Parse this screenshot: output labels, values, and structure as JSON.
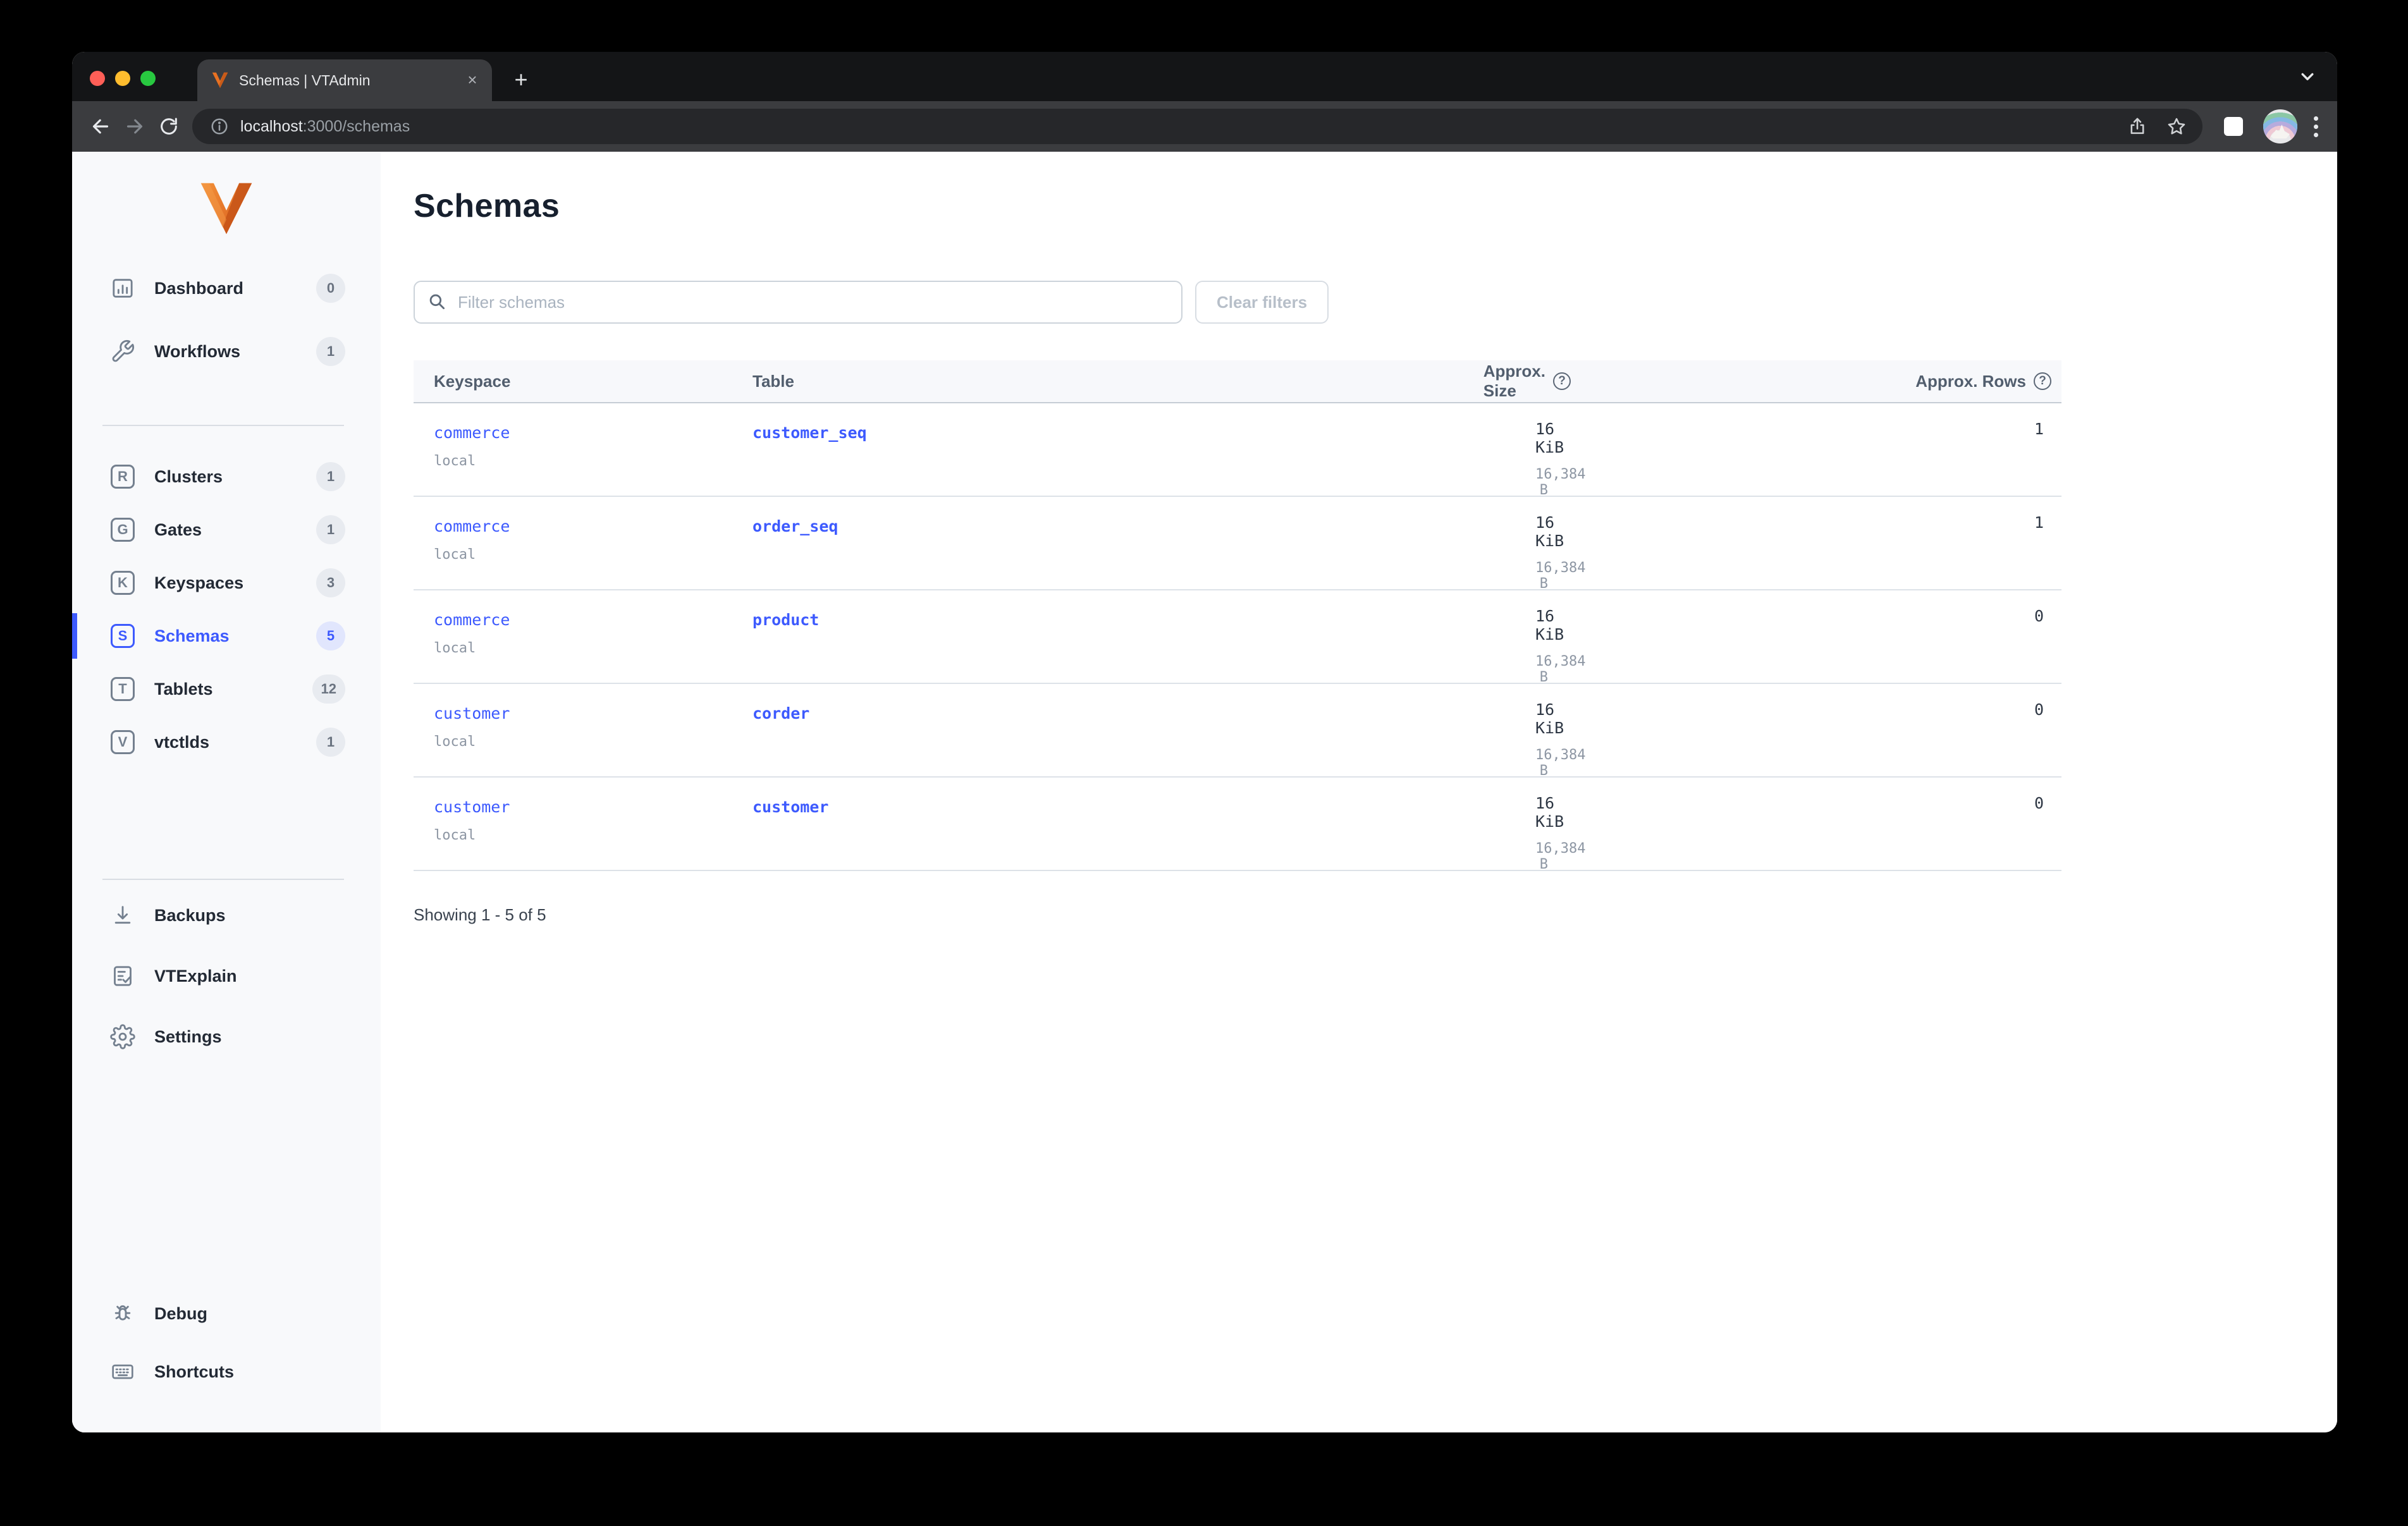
{
  "colors": {
    "accent": "#3d5afe",
    "logo_orange": "#e87122",
    "traffic_red": "#ff5f57",
    "traffic_yellow": "#febc2e",
    "traffic_green": "#28c840"
  },
  "browser": {
    "tab_title": "Schemas | VTAdmin",
    "url_host": "localhost",
    "url_rest": ":3000/schemas",
    "new_tab_glyph": "+",
    "tab_close_glyph": "×"
  },
  "sidebar": {
    "top": [
      {
        "label": "Dashboard",
        "badge": "0",
        "icon": "dashboard-icon"
      },
      {
        "label": "Workflows",
        "badge": "1",
        "icon": "wrench-icon"
      }
    ],
    "mid": [
      {
        "label": "Clusters",
        "badge": "1",
        "icon": "cluster-letter-icon",
        "letter": "R"
      },
      {
        "label": "Gates",
        "badge": "1",
        "icon": "gate-letter-icon",
        "letter": "G"
      },
      {
        "label": "Keyspaces",
        "badge": "3",
        "icon": "keyspace-letter-icon",
        "letter": "K"
      },
      {
        "label": "Schemas",
        "badge": "5",
        "icon": "schema-letter-icon",
        "letter": "S",
        "active": true
      },
      {
        "label": "Tablets",
        "badge": "12",
        "icon": "tablet-letter-icon",
        "letter": "T"
      },
      {
        "label": "vtctlds",
        "badge": "1",
        "icon": "vtctld-letter-icon",
        "letter": "V"
      }
    ],
    "tools": [
      {
        "label": "Backups",
        "icon": "download-icon"
      },
      {
        "label": "VTExplain",
        "icon": "document-check-icon"
      },
      {
        "label": "Settings",
        "icon": "gear-icon"
      }
    ],
    "bottom": [
      {
        "label": "Debug",
        "icon": "bug-icon"
      },
      {
        "label": "Shortcuts",
        "icon": "keyboard-icon"
      }
    ]
  },
  "main": {
    "title": "Schemas",
    "filter_placeholder": "Filter schemas",
    "clear_button": "Clear filters",
    "table": {
      "headers": [
        "Keyspace",
        "Table",
        "Approx. Size",
        "Approx. Rows"
      ],
      "help_glyph": "?",
      "rows": [
        {
          "keyspace": "commerce",
          "cluster": "local",
          "table": "customer_seq",
          "size": "16 KiB",
          "size_bytes": "16,384 B",
          "rows": "1"
        },
        {
          "keyspace": "commerce",
          "cluster": "local",
          "table": "order_seq",
          "size": "16 KiB",
          "size_bytes": "16,384 B",
          "rows": "1"
        },
        {
          "keyspace": "commerce",
          "cluster": "local",
          "table": "product",
          "size": "16 KiB",
          "size_bytes": "16,384 B",
          "rows": "0"
        },
        {
          "keyspace": "customer",
          "cluster": "local",
          "table": "corder",
          "size": "16 KiB",
          "size_bytes": "16,384 B",
          "rows": "0"
        },
        {
          "keyspace": "customer",
          "cluster": "local",
          "table": "customer",
          "size": "16 KiB",
          "size_bytes": "16,384 B",
          "rows": "0"
        }
      ]
    },
    "footer": "Showing 1 - 5 of 5"
  }
}
